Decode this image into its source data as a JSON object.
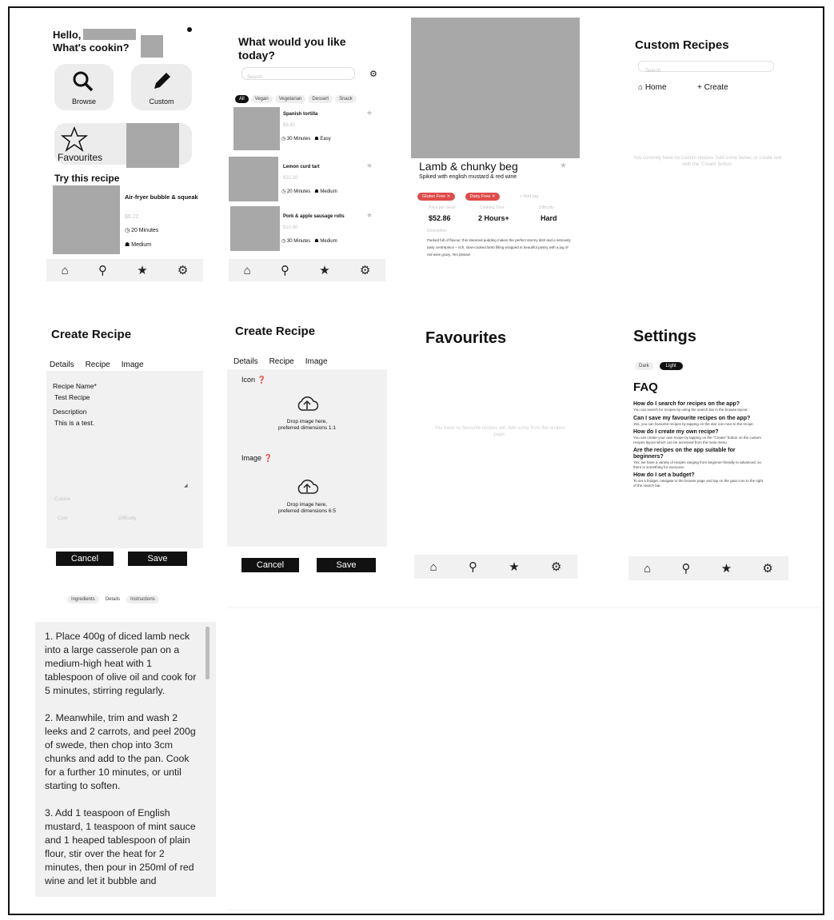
{
  "home": {
    "greeting": "Hello,",
    "subtitle": "What's cookin?",
    "browse": "Browse",
    "custom": "Custom",
    "favourites": "Favourites",
    "try_title": "Try this recipe",
    "recipe_name": "Air-fryer bubble & squeak",
    "recipe_price": "$6.22",
    "recipe_time": "20 Minutes",
    "recipe_diff": "Medium"
  },
  "browse": {
    "title": "What would you like today?",
    "search_placeholder": "Search",
    "filters": [
      "All",
      "Vegan",
      "Vegetarian",
      "Dessert",
      "Snack"
    ],
    "recipes": [
      {
        "name": "Spanish tortilla",
        "price": "$8.40",
        "time": "30 Minutes",
        "difficulty": "Easy"
      },
      {
        "name": "Lemon curd tart",
        "price": "$22.10",
        "time": "20 Minutes",
        "difficulty": "Medium"
      },
      {
        "name": "Pork & apple sausage rolls",
        "price": "$10.60",
        "time": "30 Minutes",
        "difficulty": "Medium"
      }
    ]
  },
  "detail": {
    "title": "Lamb & chunky beg",
    "subtitle": "Spiked with english mustard & red wine",
    "tags": [
      "Gluten Free",
      "Dairy Free"
    ],
    "add_tag": "+ Add tag",
    "labels": [
      "Price per serve",
      "Cooking Time",
      "Difficulty"
    ],
    "price": "$52.86",
    "time": "2 Hours+",
    "difficulty": "Hard",
    "desc_label": "Description",
    "description": "Packed full of flavour, this steamed pudding makes the perfect stormy dish and a seriously tasty centrepiece – rich, slow-cooked lamb filling wrapped in beautiful pastry with a jug of red wine gravy. Yes please!"
  },
  "custom": {
    "title": "Custom Recipes",
    "search_placeholder": "Search",
    "home_label": "Home",
    "create_label": "+ Create",
    "empty": "You currently have no custom recipes. Add some below, or create one with the 'Create' button."
  },
  "create1": {
    "title": "Create Recipe",
    "tabs": [
      "Details",
      "Recipe",
      "Image"
    ],
    "name_label": "Recipe Name",
    "name_value": "Test Recipe",
    "desc_label": "Description",
    "desc_value": "This is a test.",
    "extra1": "Cuisine",
    "extra2": "Cost",
    "extra3": "Difficulty",
    "cancel": "Cancel",
    "save": "Save"
  },
  "create2": {
    "title": "Create Recipe",
    "tabs": [
      "Details",
      "Recipe",
      "Image"
    ],
    "icon_label": "Icon",
    "icon_drop": "Drop image here,",
    "icon_dims": "preferred dimensions 1:1",
    "image_label": "Image",
    "image_drop": "Drop image here,",
    "image_dims": "preferred dimensions 6:5",
    "cancel": "Cancel",
    "save": "Save"
  },
  "favourites": {
    "title": "Favourites",
    "empty": "You have no favourite recipes yet. Add some from the recipes page."
  },
  "settings": {
    "title": "Settings",
    "dark": "Dark",
    "light": "Light",
    "faq_title": "FAQ",
    "faqs": [
      {
        "q": "How do I search for recipes on the app?",
        "a": "You can search for recipes by using the search bar in the browse layout."
      },
      {
        "q": "Can I save my favourite recipes on the app?",
        "a": "Yes, you can favourite recipes by tapping on the star icon next to the recipe."
      },
      {
        "q": "How do I create my own recipe?",
        "a": "You can create your own recipe by tapping on the \"Create\" button on the custom recipes layout which can be accessed from the main menu."
      },
      {
        "q": "Are the recipes on the app suitable for beginners?",
        "a": "Yes, we have a variety of recipes ranging from beginner-friendly to advanced, so there is something for everyone."
      },
      {
        "q": "How do I set a budget?",
        "a": "To set a budget, navigate to the browse page and tap on the gear icon to the right of the search bar."
      }
    ]
  },
  "instructions": {
    "tabs": [
      "Ingredients",
      "Details",
      "Instructions"
    ],
    "steps": [
      "1. Place 400g of diced lamb neck into a large casserole pan on a medium-high heat with 1 tablespoon of olive oil and cook for 5 minutes, stirring regularly.",
      "2. Meanwhile, trim and wash 2 leeks and 2 carrots, and peel 200g of swede, then chop into 3cm chunks and add to the pan. Cook for a further 10 minutes, or until starting to soften.",
      "3. Add 1 teaspoon of English mustard, 1 teaspoon of mint sauce and 1 heaped tablespoon of plain flour, stir over the heat for 2 minutes, then pour in 250ml of red wine and let it bubble and"
    ]
  },
  "nav_icons": [
    "home-icon",
    "search-icon",
    "star-icon",
    "gear-icon"
  ]
}
